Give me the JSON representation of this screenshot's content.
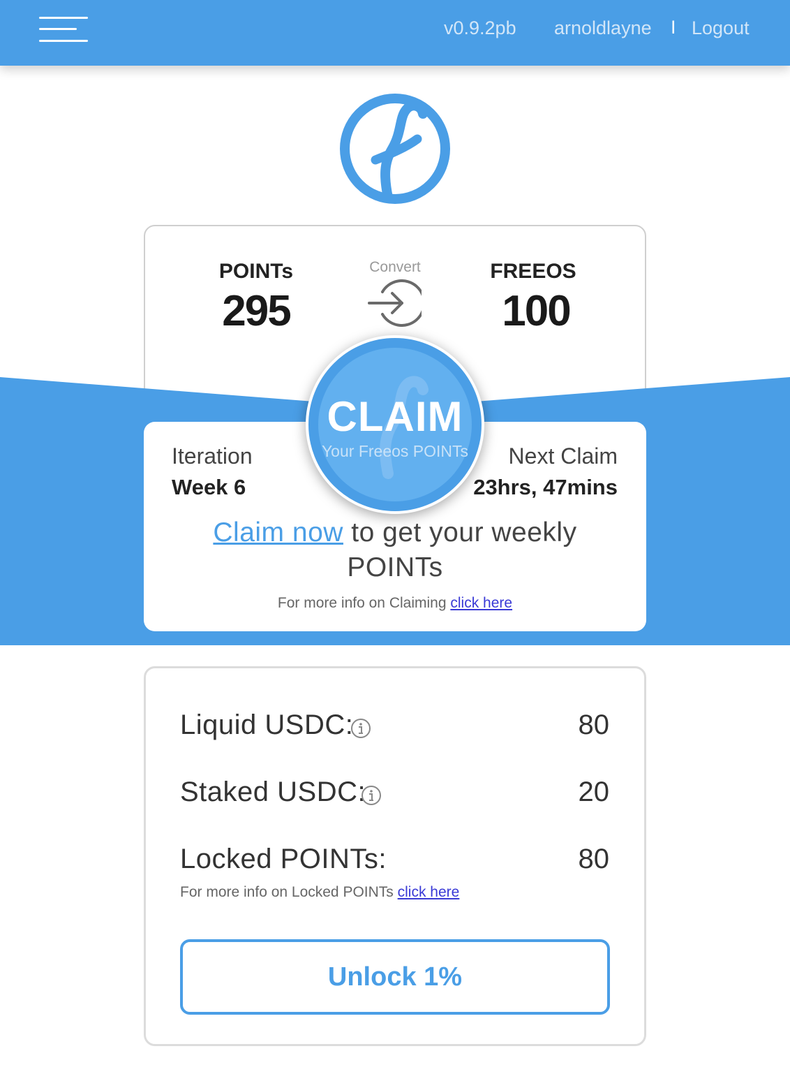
{
  "header": {
    "version": "v0.9.2pb",
    "username": "arnoldlayne",
    "separator": "I",
    "logout_label": "Logout"
  },
  "stats": {
    "points_label": "POINTs",
    "points_value": "295",
    "convert_label": "Convert",
    "freeos_label": "FREEOS",
    "freeos_value": "100"
  },
  "claim": {
    "button_title": "CLAIM",
    "button_subtitle": "Your Freeos POINTs",
    "iteration_label": "Iteration",
    "iteration_value": "Week 6",
    "next_claim_label": "Next Claim",
    "next_claim_value": "23hrs, 47mins",
    "claim_link_text": "Claim now",
    "claim_rest_text": " to get your weekly POINTs",
    "info_text": "For more info on Claiming ",
    "info_link": "click here"
  },
  "balances": {
    "liquid_label": "Liquid USDC:",
    "liquid_value": "80",
    "staked_label": "Staked USDC:",
    "staked_value": "20",
    "locked_label": "Locked POINTs:",
    "locked_value": "80",
    "locked_info_text": "For more info on Locked POINTs ",
    "locked_info_link": "click here",
    "unlock_label": "Unlock 1%"
  },
  "colors": {
    "brand_blue": "#4a9ee6",
    "link_blue": "#3a3ad6"
  },
  "icons": {
    "menu": "hamburger-icon",
    "logo": "freeos-logo-icon",
    "convert": "convert-arrow-icon",
    "info": "info-icon"
  }
}
